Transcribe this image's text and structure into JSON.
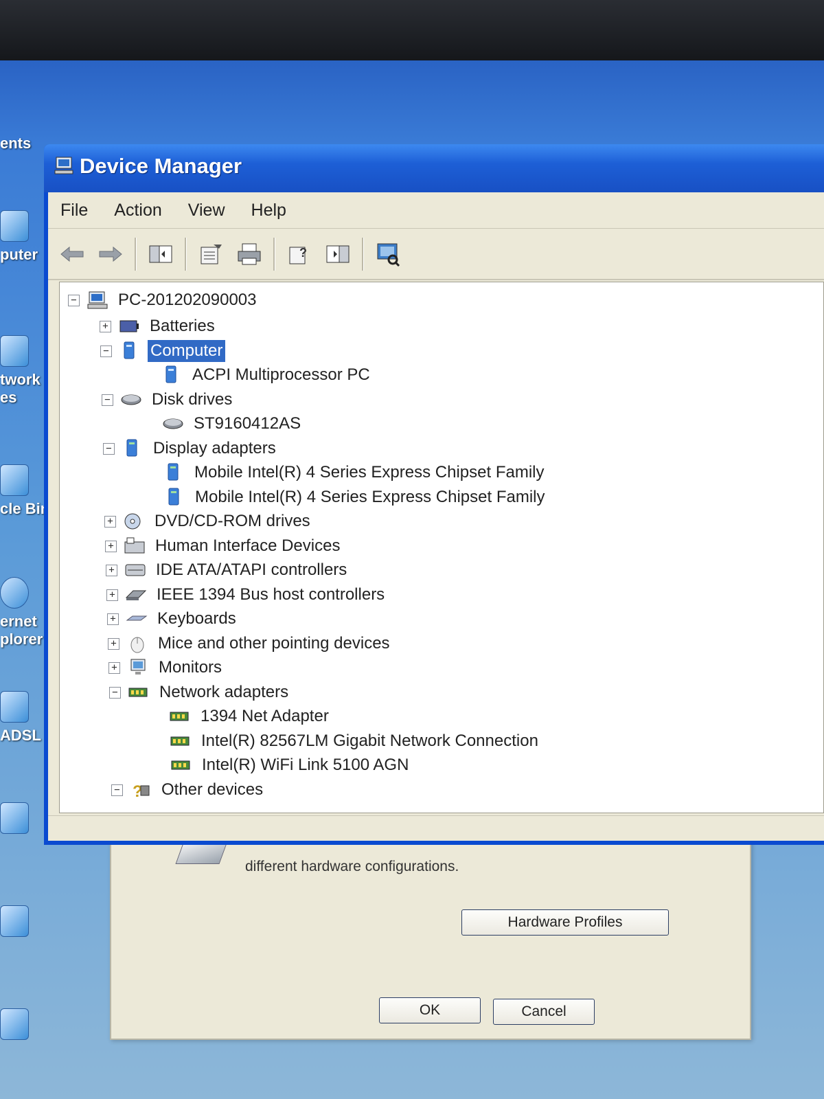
{
  "desktop": {
    "icons": [
      {
        "label": "ents"
      },
      {
        "label": "puter"
      },
      {
        "label": "twork"
      },
      {
        "label": "es"
      },
      {
        "label": "cle Bin"
      },
      {
        "label": "ernet"
      },
      {
        "label": "plorer"
      },
      {
        "label": "ADSL"
      }
    ]
  },
  "window": {
    "title": "Device Manager",
    "menu": [
      "File",
      "Action",
      "View",
      "Help"
    ],
    "toolbar_icons": [
      "back-icon",
      "forward-icon",
      "show-hide-tree-icon",
      "properties-icon",
      "print-icon",
      "help-icon",
      "update-driver-icon",
      "scan-hardware-icon"
    ]
  },
  "tree": {
    "root": "PC-201202090003",
    "items": [
      {
        "label": "Batteries",
        "expander": "+",
        "level": 1,
        "icon": "battery-icon"
      },
      {
        "label": "Computer",
        "expander": "−",
        "level": 1,
        "icon": "computer-icon",
        "selected": true
      },
      {
        "label": "ACPI Multiprocessor PC",
        "expander": "",
        "level": 2,
        "icon": "computer-icon"
      },
      {
        "label": "Disk drives",
        "expander": "−",
        "level": 1,
        "icon": "disk-drive-icon"
      },
      {
        "label": "ST9160412AS",
        "expander": "",
        "level": 2,
        "icon": "disk-drive-icon"
      },
      {
        "label": "Display adapters",
        "expander": "−",
        "level": 1,
        "icon": "display-adapter-icon"
      },
      {
        "label": "Mobile Intel(R) 4 Series Express Chipset Family",
        "expander": "",
        "level": 2,
        "icon": "display-adapter-icon"
      },
      {
        "label": "Mobile Intel(R) 4 Series Express Chipset Family",
        "expander": "",
        "level": 2,
        "icon": "display-adapter-icon"
      },
      {
        "label": "DVD/CD-ROM drives",
        "expander": "+",
        "level": 1,
        "icon": "dvd-drive-icon"
      },
      {
        "label": "Human Interface Devices",
        "expander": "+",
        "level": 1,
        "icon": "hid-icon"
      },
      {
        "label": "IDE ATA/ATAPI controllers",
        "expander": "+",
        "level": 1,
        "icon": "ide-controller-icon"
      },
      {
        "label": "IEEE 1394 Bus host controllers",
        "expander": "+",
        "level": 1,
        "icon": "ieee1394-icon"
      },
      {
        "label": "Keyboards",
        "expander": "+",
        "level": 1,
        "icon": "keyboard-icon"
      },
      {
        "label": "Mice and other pointing devices",
        "expander": "+",
        "level": 1,
        "icon": "mouse-icon"
      },
      {
        "label": "Monitors",
        "expander": "+",
        "level": 1,
        "icon": "monitor-icon"
      },
      {
        "label": "Network adapters",
        "expander": "−",
        "level": 1,
        "icon": "network-adapter-icon"
      },
      {
        "label": "1394 Net Adapter",
        "expander": "",
        "level": 2,
        "icon": "network-adapter-icon"
      },
      {
        "label": "Intel(R) 82567LM Gigabit Network Connection",
        "expander": "",
        "level": 2,
        "icon": "network-adapter-icon"
      },
      {
        "label": "Intel(R) WiFi Link 5100 AGN",
        "expander": "",
        "level": 2,
        "icon": "network-adapter-icon"
      },
      {
        "label": "Other devices",
        "expander": "−",
        "level": 1,
        "icon": "other-devices-icon"
      }
    ]
  },
  "system_properties": {
    "description": "different hardware configurations.",
    "hardware_profiles_label": "Hardware Profiles",
    "ok_label": "OK",
    "cancel_label": "Cancel"
  }
}
